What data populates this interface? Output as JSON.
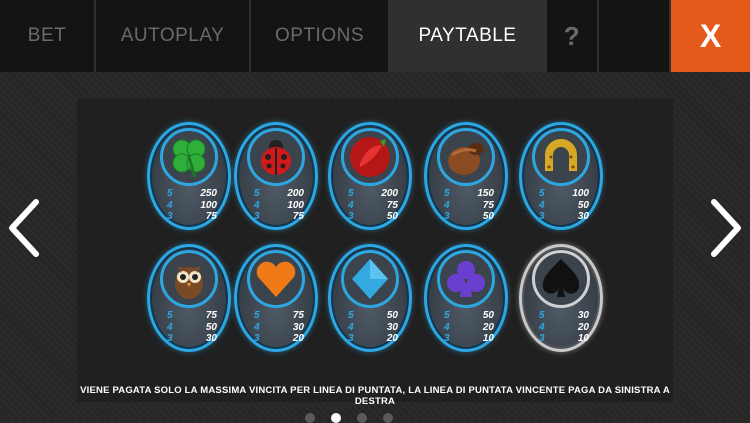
{
  "tabs": [
    {
      "label": "BET",
      "active": false
    },
    {
      "label": "AUTOPLAY",
      "active": false
    },
    {
      "label": "OPTIONS",
      "active": false
    },
    {
      "label": "PAYTABLE",
      "active": true
    }
  ],
  "help_label": "?",
  "close_label": "X",
  "colors": {
    "accent": "#e55a1b",
    "blue": "#2da7e2"
  },
  "symbols": [
    {
      "name": "clover-icon",
      "pays": [
        {
          "n": "5",
          "v": "250"
        },
        {
          "n": "4",
          "v": "100"
        },
        {
          "n": "3",
          "v": "75"
        }
      ]
    },
    {
      "name": "ladybug-icon",
      "pays": [
        {
          "n": "5",
          "v": "200"
        },
        {
          "n": "4",
          "v": "100"
        },
        {
          "n": "3",
          "v": "75"
        }
      ]
    },
    {
      "name": "chili-pepper-icon",
      "pays": [
        {
          "n": "5",
          "v": "200"
        },
        {
          "n": "4",
          "v": "75"
        },
        {
          "n": "3",
          "v": "50"
        }
      ]
    },
    {
      "name": "pot-icon",
      "pays": [
        {
          "n": "5",
          "v": "150"
        },
        {
          "n": "4",
          "v": "75"
        },
        {
          "n": "3",
          "v": "50"
        }
      ]
    },
    {
      "name": "horseshoe-icon",
      "pays": [
        {
          "n": "5",
          "v": "100"
        },
        {
          "n": "4",
          "v": "50"
        },
        {
          "n": "3",
          "v": "30"
        }
      ]
    },
    {
      "name": "owl-icon",
      "pays": [
        {
          "n": "5",
          "v": "75"
        },
        {
          "n": "4",
          "v": "50"
        },
        {
          "n": "3",
          "v": "30"
        }
      ]
    },
    {
      "name": "heart-icon",
      "pays": [
        {
          "n": "5",
          "v": "75"
        },
        {
          "n": "4",
          "v": "30"
        },
        {
          "n": "3",
          "v": "20"
        }
      ]
    },
    {
      "name": "diamond-icon",
      "pays": [
        {
          "n": "5",
          "v": "50"
        },
        {
          "n": "4",
          "v": "30"
        },
        {
          "n": "3",
          "v": "20"
        }
      ]
    },
    {
      "name": "club-icon",
      "pays": [
        {
          "n": "5",
          "v": "50"
        },
        {
          "n": "4",
          "v": "20"
        },
        {
          "n": "3",
          "v": "10"
        }
      ]
    },
    {
      "name": "spade-icon",
      "pays": [
        {
          "n": "5",
          "v": "30"
        },
        {
          "n": "4",
          "v": "20"
        },
        {
          "n": "3",
          "v": "10"
        }
      ]
    }
  ],
  "footnote": "VIENE PAGATA SOLO LA MASSIMA VINCITA PER LINEA DI PUNTATA, LA LINEA DI PUNTATA VINCENTE PAGA DA SINISTRA A DESTRA",
  "pagination": {
    "pages": 4,
    "current": 2
  }
}
